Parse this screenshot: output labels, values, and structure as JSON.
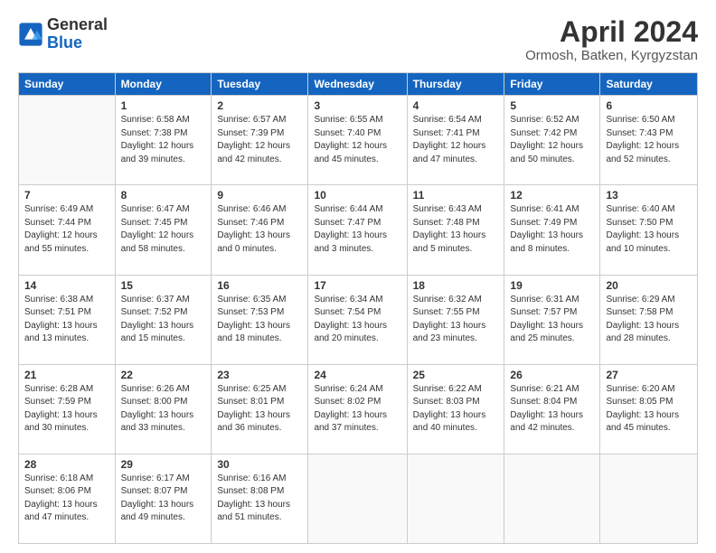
{
  "header": {
    "logo_general": "General",
    "logo_blue": "Blue",
    "main_title": "April 2024",
    "sub_title": "Ormosh, Batken, Kyrgyzstan"
  },
  "calendar": {
    "days_of_week": [
      "Sunday",
      "Monday",
      "Tuesday",
      "Wednesday",
      "Thursday",
      "Friday",
      "Saturday"
    ],
    "weeks": [
      [
        {
          "day": "",
          "info": ""
        },
        {
          "day": "1",
          "info": "Sunrise: 6:58 AM\nSunset: 7:38 PM\nDaylight: 12 hours\nand 39 minutes."
        },
        {
          "day": "2",
          "info": "Sunrise: 6:57 AM\nSunset: 7:39 PM\nDaylight: 12 hours\nand 42 minutes."
        },
        {
          "day": "3",
          "info": "Sunrise: 6:55 AM\nSunset: 7:40 PM\nDaylight: 12 hours\nand 45 minutes."
        },
        {
          "day": "4",
          "info": "Sunrise: 6:54 AM\nSunset: 7:41 PM\nDaylight: 12 hours\nand 47 minutes."
        },
        {
          "day": "5",
          "info": "Sunrise: 6:52 AM\nSunset: 7:42 PM\nDaylight: 12 hours\nand 50 minutes."
        },
        {
          "day": "6",
          "info": "Sunrise: 6:50 AM\nSunset: 7:43 PM\nDaylight: 12 hours\nand 52 minutes."
        }
      ],
      [
        {
          "day": "7",
          "info": "Sunrise: 6:49 AM\nSunset: 7:44 PM\nDaylight: 12 hours\nand 55 minutes."
        },
        {
          "day": "8",
          "info": "Sunrise: 6:47 AM\nSunset: 7:45 PM\nDaylight: 12 hours\nand 58 minutes."
        },
        {
          "day": "9",
          "info": "Sunrise: 6:46 AM\nSunset: 7:46 PM\nDaylight: 13 hours\nand 0 minutes."
        },
        {
          "day": "10",
          "info": "Sunrise: 6:44 AM\nSunset: 7:47 PM\nDaylight: 13 hours\nand 3 minutes."
        },
        {
          "day": "11",
          "info": "Sunrise: 6:43 AM\nSunset: 7:48 PM\nDaylight: 13 hours\nand 5 minutes."
        },
        {
          "day": "12",
          "info": "Sunrise: 6:41 AM\nSunset: 7:49 PM\nDaylight: 13 hours\nand 8 minutes."
        },
        {
          "day": "13",
          "info": "Sunrise: 6:40 AM\nSunset: 7:50 PM\nDaylight: 13 hours\nand 10 minutes."
        }
      ],
      [
        {
          "day": "14",
          "info": "Sunrise: 6:38 AM\nSunset: 7:51 PM\nDaylight: 13 hours\nand 13 minutes."
        },
        {
          "day": "15",
          "info": "Sunrise: 6:37 AM\nSunset: 7:52 PM\nDaylight: 13 hours\nand 15 minutes."
        },
        {
          "day": "16",
          "info": "Sunrise: 6:35 AM\nSunset: 7:53 PM\nDaylight: 13 hours\nand 18 minutes."
        },
        {
          "day": "17",
          "info": "Sunrise: 6:34 AM\nSunset: 7:54 PM\nDaylight: 13 hours\nand 20 minutes."
        },
        {
          "day": "18",
          "info": "Sunrise: 6:32 AM\nSunset: 7:55 PM\nDaylight: 13 hours\nand 23 minutes."
        },
        {
          "day": "19",
          "info": "Sunrise: 6:31 AM\nSunset: 7:57 PM\nDaylight: 13 hours\nand 25 minutes."
        },
        {
          "day": "20",
          "info": "Sunrise: 6:29 AM\nSunset: 7:58 PM\nDaylight: 13 hours\nand 28 minutes."
        }
      ],
      [
        {
          "day": "21",
          "info": "Sunrise: 6:28 AM\nSunset: 7:59 PM\nDaylight: 13 hours\nand 30 minutes."
        },
        {
          "day": "22",
          "info": "Sunrise: 6:26 AM\nSunset: 8:00 PM\nDaylight: 13 hours\nand 33 minutes."
        },
        {
          "day": "23",
          "info": "Sunrise: 6:25 AM\nSunset: 8:01 PM\nDaylight: 13 hours\nand 36 minutes."
        },
        {
          "day": "24",
          "info": "Sunrise: 6:24 AM\nSunset: 8:02 PM\nDaylight: 13 hours\nand 37 minutes."
        },
        {
          "day": "25",
          "info": "Sunrise: 6:22 AM\nSunset: 8:03 PM\nDaylight: 13 hours\nand 40 minutes."
        },
        {
          "day": "26",
          "info": "Sunrise: 6:21 AM\nSunset: 8:04 PM\nDaylight: 13 hours\nand 42 minutes."
        },
        {
          "day": "27",
          "info": "Sunrise: 6:20 AM\nSunset: 8:05 PM\nDaylight: 13 hours\nand 45 minutes."
        }
      ],
      [
        {
          "day": "28",
          "info": "Sunrise: 6:18 AM\nSunset: 8:06 PM\nDaylight: 13 hours\nand 47 minutes."
        },
        {
          "day": "29",
          "info": "Sunrise: 6:17 AM\nSunset: 8:07 PM\nDaylight: 13 hours\nand 49 minutes."
        },
        {
          "day": "30",
          "info": "Sunrise: 6:16 AM\nSunset: 8:08 PM\nDaylight: 13 hours\nand 51 minutes."
        },
        {
          "day": "",
          "info": ""
        },
        {
          "day": "",
          "info": ""
        },
        {
          "day": "",
          "info": ""
        },
        {
          "day": "",
          "info": ""
        }
      ]
    ]
  }
}
